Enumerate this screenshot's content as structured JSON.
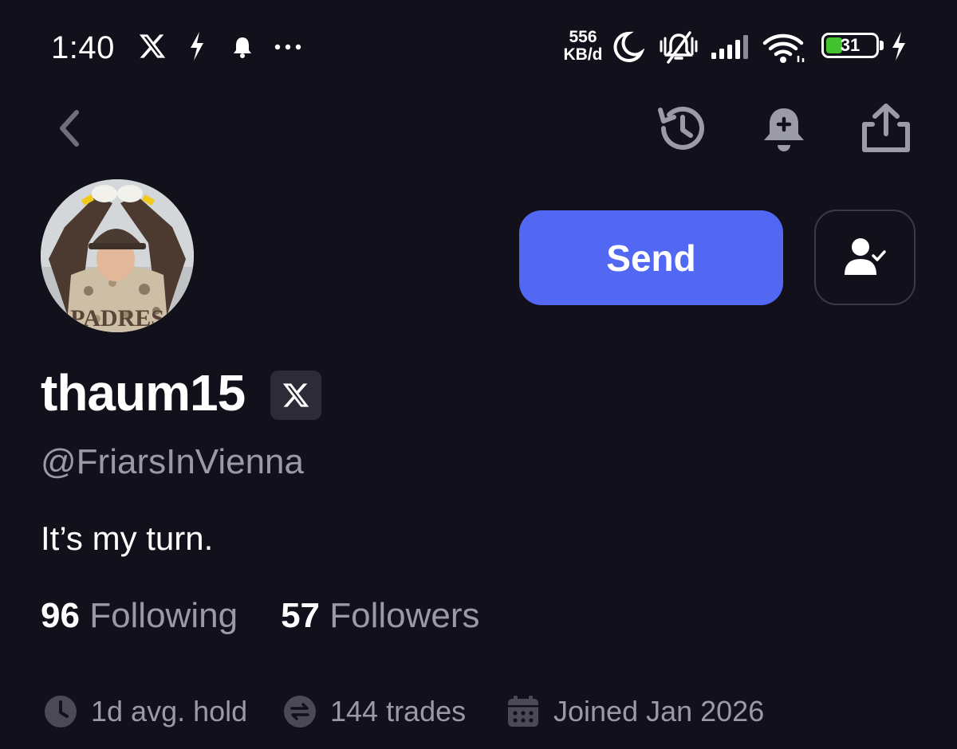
{
  "status_bar": {
    "time": "1:40",
    "net_speed_value": "556",
    "net_speed_unit": "KB/d",
    "battery_level": "31",
    "icons": [
      "x-logo-icon",
      "flash-icon",
      "notification-bell-icon",
      "more-dots-icon",
      "moon-icon",
      "muted-bell-icon",
      "signal-icon",
      "wifi-icon",
      "battery-icon",
      "charging-icon"
    ]
  },
  "top_nav": {
    "icons": [
      "back-chevron-icon",
      "history-icon",
      "notify-add-icon",
      "share-icon"
    ]
  },
  "profile": {
    "display_name": "thaum15",
    "handle": "@FriarsInVienna",
    "bio": "It’s my turn.",
    "avatar_caption": "PADRES"
  },
  "actions": {
    "send_label": "Send",
    "follow_icon": "person-check-icon"
  },
  "stats": {
    "following_count": "96",
    "following_label": "Following",
    "followers_count": "57",
    "followers_label": "Followers"
  },
  "meta": {
    "avg_hold": "1d avg. hold",
    "trades": "144 trades",
    "joined": "Joined Jan 2026"
  },
  "colors": {
    "background": "#12111b",
    "accent": "#5368f2",
    "muted_text": "#9a99a8",
    "battery_green": "#43c42f"
  }
}
